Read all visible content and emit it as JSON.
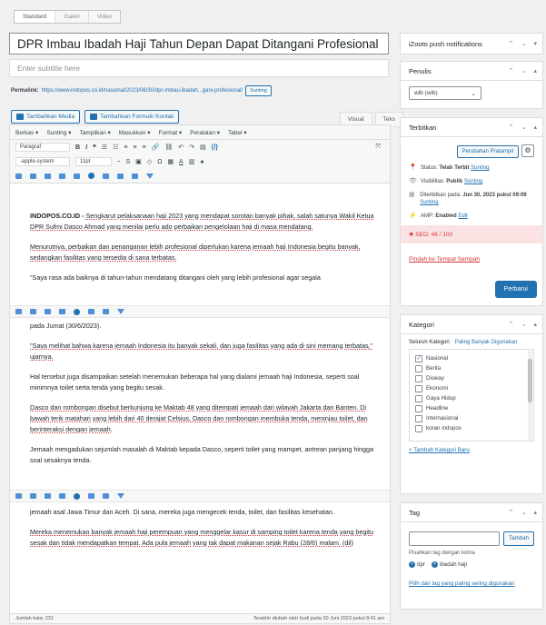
{
  "format_tabs": [
    "Standard",
    "Galeri",
    "Video"
  ],
  "post": {
    "title": "DPR Imbau Ibadah Haji Tahun Depan Dapat Ditangani Profesional",
    "subtitle_placeholder": "Enter subtitle here",
    "permalink_label": "Permalink:",
    "permalink_url": "https://www.indopos.co.id/nasional/2023/06/30/dpr-imbau-ibadah...gani-profesional/",
    "permalink_edit": "Sunting"
  },
  "media": {
    "add_media": "Tambahkan Media",
    "add_form": "Tambahkan Formulir Kontak"
  },
  "editor_tabs": [
    "Visual",
    "Teks"
  ],
  "menubar": [
    "Berkas ▾",
    "Sunting ▾",
    "Tampilkan ▾",
    "Masukkan ▾",
    "Format ▾",
    "Peralatan ▾",
    "Tabel ▾"
  ],
  "toolbar": {
    "paragraph": "Paragraf",
    "font_family": "-apple-system",
    "font_size": "11pt"
  },
  "content": {
    "p1_lead": "INDOPOS.CO.ID - ",
    "p1": "Sengkarut pelaksanaan haji 2023 yang mendapat sorotan banyak pihak, salah satunya Wakil Ketua DPR Sufmi Dasco Ahmad yang menilai perlu ado perbaikan pengelolaan haji di masa mendatang.",
    "p2": "Menurutnya, perbaikan dan penanganan lebih profesional diperlukan karena jemaah haji Indonesia begitu banyak, sedangkan fasilitas yang tersedia di sana terbatas.",
    "p3": "\"Saya rasa ada baiknya di tahun-tahun mendatang ditangani oleh yang lebih profesional agar segala",
    "p3b": "pada Jumat (30/6/2023).",
    "p4": "\"Saya melihat bahwa karena jemaah Indonesia itu banyak sekali, dan juga fasilitas yang ada di sini memang terbatas,\" ujarnya.",
    "p5": "Hal tersebut juga disampaikan setelah menemukan beberapa hal yang dialami jemaah haji Indonesia, seperti soal minimnya toilet serta tenda yang begitu sesak.",
    "p6": "Dasco dan rombongan disebut berkunjung ke Maktab 48 yang ditempati jemaah dari wilayah Jakarta dan Banten. Di bawah terik matahari yang lebih dari 40 derajat Celsius, Dasco dan rombongan membuka tenda, meninjau toilet, dan berinteraksi dengan jemaah.",
    "p7": "Jemaah mengadukan sejumlah masalah di Maktab kepada Dasco, seperti toilet yang mampet, antrean panjang hingga soal sesaknya tenda.",
    "p8": "jemaah asal Jawa Timur dan Aceh. Di sana, mereka juga mengecek tenda, toilet, dan fasilitas kesehatan.",
    "p9": "Mereka menemukan banyak jemaah haji perempuan yang menggelar kasur di samping toilet karena tenda yang begitu sesak dan tidak mendapatkan tempat. Ada pula jemaah yang tak dapat makanan sejak Rabu (28/6) malam. (dil)"
  },
  "status": {
    "word_count": "Jumlah kata: 231",
    "last_edit": "Terakhir diubah oleh budi pada 30 Juni 2023 pukul 8:41 am"
  },
  "sidebar": {
    "izooto": "iZooto push notifications",
    "author_title": "Penulis",
    "author_value": "wib (wib)",
    "publish_title": "Terbitkan",
    "preview_btn": "Perubahan Pratampil",
    "status_label": "Status: ",
    "status_value": "Telah Terbit",
    "status_edit": "Sunting",
    "visibility_label": "Visibilitas: ",
    "visibility_value": "Publik",
    "visibility_edit": "Sunting",
    "published_on_label": "Diterbitkan pada: ",
    "published_on_value": "Jun 30, 2023 pukul 09:09",
    "published_edit": "Sunting",
    "amp_label": "AMP: ",
    "amp_value": "Enabled",
    "amp_edit": "Edit",
    "seo": "SEO: 48 / 100",
    "trash": "Pindah ke Tempat Sampah",
    "publish_btn": "Perbarui",
    "category_title": "Kategori",
    "cat_tab_all": "Seluruh Kategori",
    "cat_tab_popular": "Paling Banyak Digunakan",
    "categories": [
      "Nasional",
      "Berita",
      "Disway",
      "Ekonomi",
      "Gaya Hidup",
      "Headline",
      "Internasional",
      "koran indopos"
    ],
    "add_category": "+ Tambah Kategori Baru",
    "tag_title": "Tag",
    "tag_add": "Tambah",
    "tag_hint": "Pisahkan tag dengan koma",
    "tags": [
      "dpr",
      "ibadah haji"
    ],
    "tag_popular": "Pilih dari tag yang paling sering digunakan"
  },
  "colors": {
    "accent": "#2271b1",
    "danger": "#d63638",
    "seo_bg": "#fbe3e4"
  }
}
